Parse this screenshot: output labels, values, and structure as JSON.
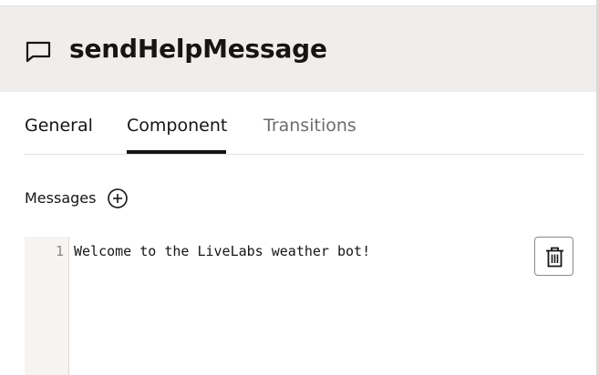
{
  "header": {
    "title": "sendHelpMessage",
    "icon": "chat-bubble-icon"
  },
  "tabs": [
    {
      "label": "General",
      "active": false
    },
    {
      "label": "Component",
      "active": true
    },
    {
      "label": "Transitions",
      "active": false
    }
  ],
  "messages": {
    "label": "Messages",
    "add_icon": "plus-circle-icon",
    "delete_icon": "trash-icon",
    "editor": {
      "lines": [
        {
          "number": "1",
          "text": "Welcome to the LiveLabs weather bot!"
        }
      ]
    }
  },
  "colors": {
    "header_bg": "#f0eeec",
    "text": "#161513",
    "inactive_tab": "#6f6c69",
    "gutter_bg": "#f5f4f2",
    "border": "#dcd9d4"
  }
}
